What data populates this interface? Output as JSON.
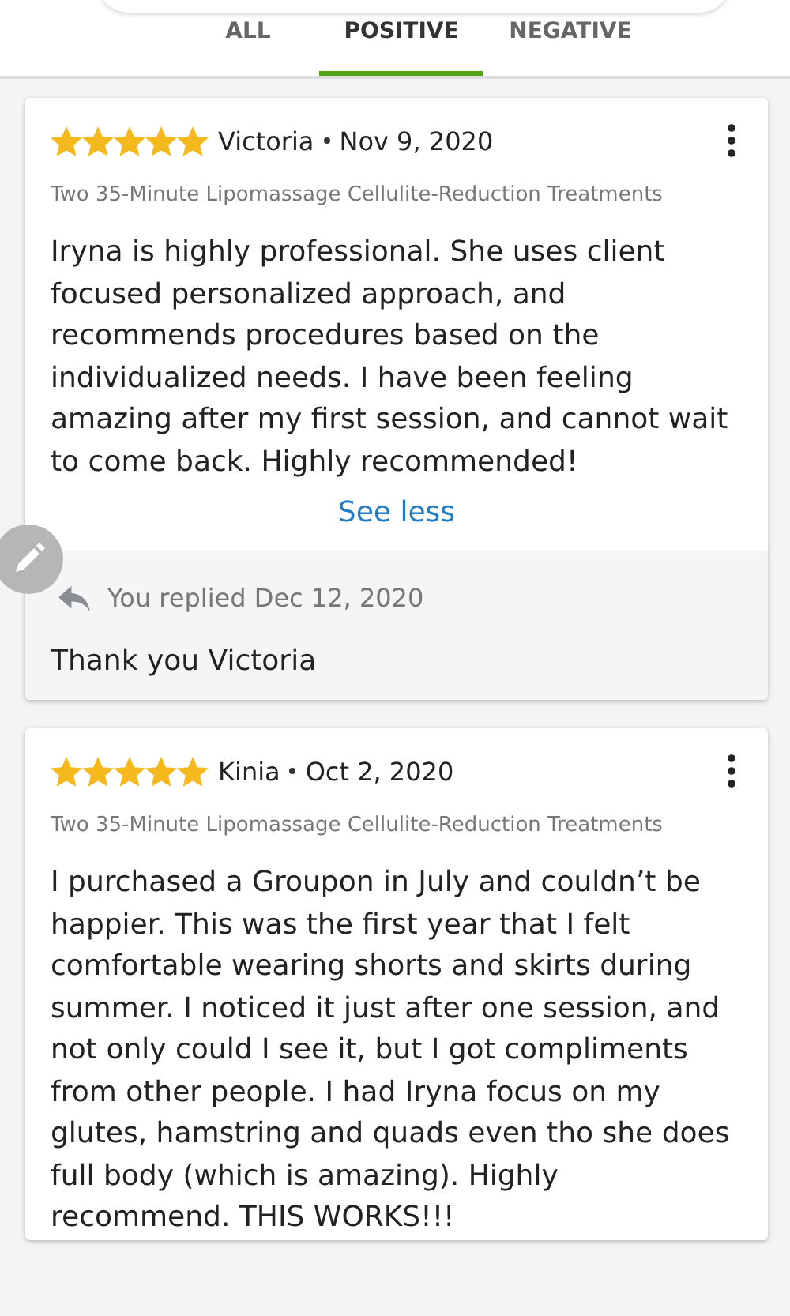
{
  "tabs": [
    {
      "label": "ALL",
      "selected": false
    },
    {
      "label": "POSITIVE",
      "selected": true
    },
    {
      "label": "NEGATIVE",
      "selected": false
    }
  ],
  "reviews": [
    {
      "stars": 5,
      "author": "Victoria",
      "date": "Nov 9, 2020",
      "service": "Two 35-Minute Lipomassage Cellulite-Reduction Treatments",
      "body": "Iryna is highly professional. She uses client focused personalized approach, and recommends procedures based on the individualized needs. I have been feeling amazing after my first session, and cannot wait to come back. Highly recommended!",
      "toggle_link": "See less",
      "reply": {
        "label": "You replied Dec 12, 2020",
        "text": "Thank you Victoria"
      }
    },
    {
      "stars": 5,
      "author": "Kinia",
      "date": "Oct 2, 2020",
      "service": "Two 35-Minute Lipomassage Cellulite-Reduction Treatments",
      "body": "I purchased a Groupon in July and couldn’t be happier. This was the first year that I felt comfortable wearing shorts and skirts during summer. I noticed it just after one session, and not only could I see it, but I got compliments from other people. I had Iryna focus on my glutes, hamstring and quads even tho she does full body (which is amazing). Highly recommend. THIS WORKS!!!"
    }
  ]
}
